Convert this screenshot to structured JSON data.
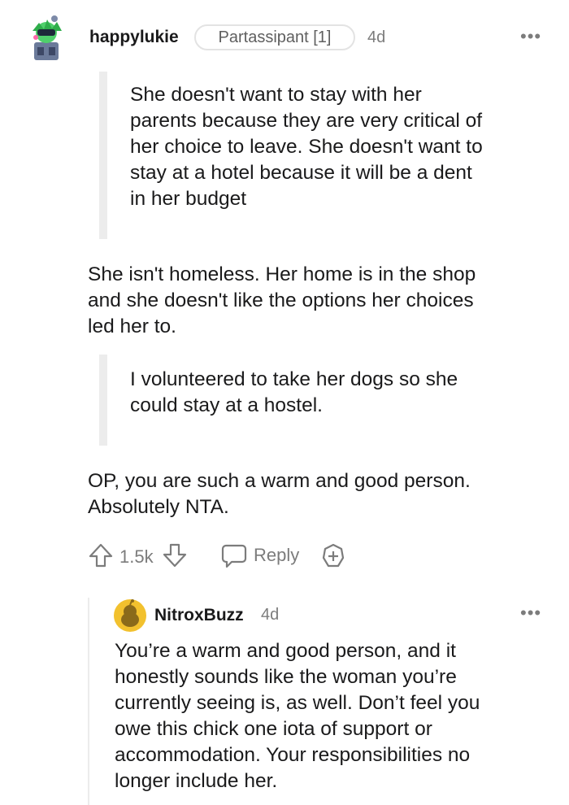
{
  "comment": {
    "username": "happylukie",
    "flair": "Partassipant [1]",
    "age": "4d",
    "more": "•••",
    "quote1": "She doesn't want to stay with her\nparents because they are very critical of\nher choice to leave. She doesn't want to\nstay at a hotel because it will be a dent\nin her budget",
    "para1": "She isn't homeless. Her home is in the shop\nand she doesn't like the options her choices\nled her to.",
    "quote2": "I volunteered to take her dogs so she\ncould stay at a hostel.",
    "para2": "OP, you are such a warm and good person.\nAbsolutely NTA.",
    "votes": "1.5k",
    "reply_label": "Reply"
  },
  "reply": {
    "username": "NitroxBuzz",
    "age": "4d",
    "more": "•••",
    "body": "You’re a warm and good person, and it\nhonestly sounds like the woman you’re\ncurrently seeing is, as well. Don’t feel you\nowe this chick one iota of support or\naccommodation. Your responsibilities no\nlonger include her."
  },
  "colors": {
    "text": "#1a1a1b",
    "meta": "#7c7c7c",
    "quote_bar": "#ececec",
    "reply_avatar": "#f2c12e"
  },
  "icons": [
    "avatar-image",
    "upvote-icon",
    "downvote-icon",
    "reply-icon",
    "award-icon",
    "snoo-avatar-icon"
  ]
}
